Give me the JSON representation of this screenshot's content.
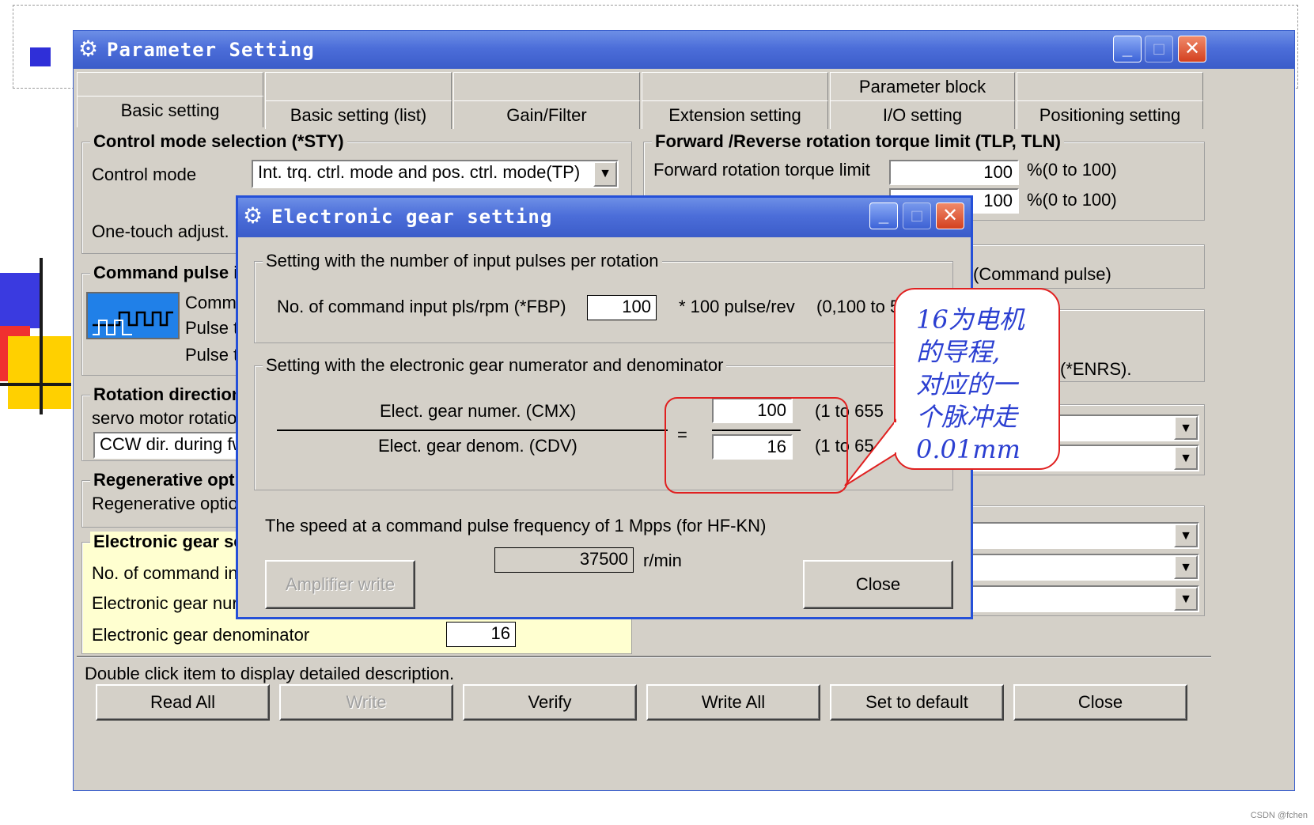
{
  "window": {
    "title": "Parameter Setting",
    "icon": "gear-icon"
  },
  "tabs": {
    "row_top": [
      "",
      "",
      "",
      "",
      "Parameter block",
      ""
    ],
    "row_bottom": [
      "Basic setting",
      "Basic setting (list)",
      "Gain/Filter",
      "Extension setting",
      "I/O setting",
      "Positioning setting"
    ],
    "active": "Basic setting"
  },
  "control_mode": {
    "title": "Control mode selection (*STY)",
    "control_mode_label": "Control mode",
    "control_mode_value": "Int. trq. ctrl. mode and pos. ctrl. mode(TP)",
    "one_touch_label": "One-touch adjust."
  },
  "torque_limit": {
    "title": "Forward /Reverse rotation torque limit (TLP, TLN)",
    "forward_label": "Forward rotation torque limit",
    "forward_value": "100",
    "forward_unit": "%(0 to 100)",
    "reverse_value": "100",
    "reverse_unit": "%(0 to 100)"
  },
  "command_pulse": {
    "title": "Command pulse i",
    "line1": "Comm",
    "line2": "Pulse t",
    "line3": "Pulse t",
    "right_label": "(Command pulse)"
  },
  "rotation": {
    "title": "Rotation direction",
    "line1": "servo motor rotatio",
    "value": "CCW dir. during fw",
    "enrs_label": "(*ENRS)."
  },
  "regen": {
    "title": "Regenerative opti",
    "line1": "Regenerative optio"
  },
  "electronic_gear": {
    "title": "Electronic gear se",
    "line1": "No. of command in",
    "line2": "Electronic gear nur",
    "line3": "Electronic gear denominator",
    "denominator_value": "16"
  },
  "status_text": "Double click item to display detailed description.",
  "bottom_buttons": [
    "Read All",
    "Write",
    "Verify",
    "Write All",
    "Set to default",
    "Close"
  ],
  "dialog": {
    "title": "Electronic gear setting",
    "group1_title": "Setting with the number of input pulses per rotation",
    "fbp_label": "No. of command input pls/rpm (*FBP)",
    "fbp_value": "100",
    "fbp_unit": "* 100 pulse/rev",
    "fbp_range": "(0,100 to 5",
    "group2_title": "Setting with the electronic gear numerator and denominator",
    "cmx_label": "Elect. gear numer. (CMX)",
    "cmx_value": "100",
    "cmx_range": "(1 to 655",
    "cdv_label": "Elect. gear denom. (CDV)",
    "cdv_value": "16",
    "cdv_range": "(1 to 65",
    "equals": "=",
    "speed_label": "The speed at a command pulse frequency of 1 Mpps (for HF-KN)",
    "speed_value": "37500",
    "speed_unit": "r/min",
    "amp_write": "Amplifier write",
    "close": "Close"
  },
  "annotation": {
    "lines": [
      "16为电机",
      "的导程,",
      "对应的一",
      "个脉冲走",
      "0.01mm"
    ]
  },
  "watermark": "CSDN @fchen",
  "colors": {
    "title_blue": "#3b5cc9",
    "window_gray": "#d4d0c8",
    "annotation_red": "#e02020",
    "annotation_blue": "#2b3fd1",
    "highlight_yellow": "#ffffd0"
  }
}
